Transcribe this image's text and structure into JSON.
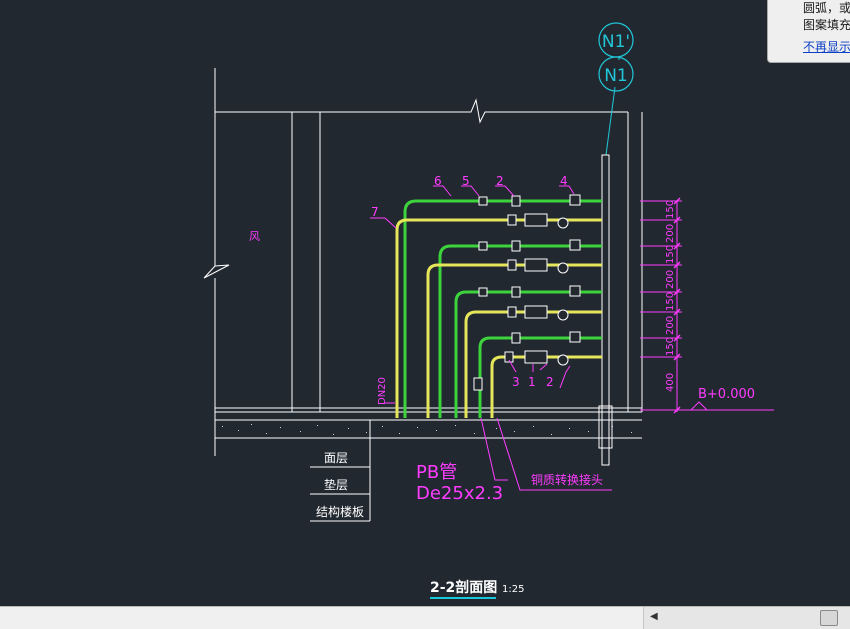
{
  "tooltip": {
    "line1": "圆弧，或",
    "line2": "图案填充",
    "dismiss_link": "不再显示"
  },
  "drawing": {
    "bubble_top": "N1'",
    "bubble_bottom": "N1",
    "room_label": "风",
    "callouts": [
      "6",
      "5",
      "2",
      "4",
      "7"
    ],
    "bottom_callouts": [
      "3",
      "1",
      "2"
    ],
    "dim_values": [
      "150",
      "200",
      "150",
      "200",
      "150",
      "200",
      "150",
      "400"
    ],
    "elevation": "B+0.000",
    "pipe_size_label": "DN20",
    "layer_labels": [
      "面层",
      "垫层",
      "结构楼板"
    ],
    "pipe_material": "PB管",
    "pipe_spec": "De25x2.3",
    "joint_note": "铜质转换接头",
    "section_title": "2-2剖面图",
    "scale": "1:25"
  },
  "colors": {
    "background": "#212830",
    "linework": "#ffffff",
    "supply_pipe": "#3cd33c",
    "return_pipe": "#e6e65a",
    "magenta": "#ff3cff",
    "cyan": "#22c8d8",
    "title_underline": "#18c8d8"
  }
}
